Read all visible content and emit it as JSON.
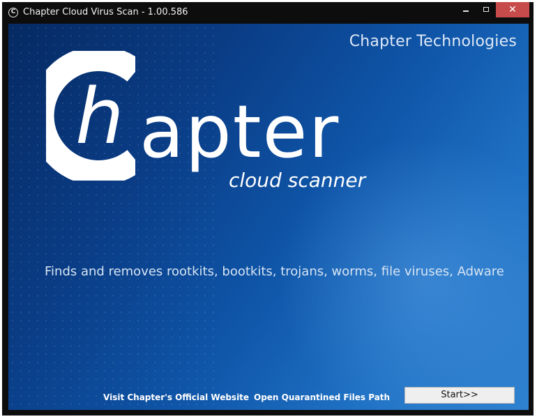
{
  "window": {
    "title": "Chapter Cloud Virus Scan - 1.00.586",
    "icon": "chapter-app-icon",
    "close_glyph": "✕"
  },
  "header": {
    "company": "Chapter Technologies"
  },
  "logo": {
    "letter_c": "C",
    "letter_h": "h",
    "word_rest": "apter",
    "subtitle": "cloud scanner"
  },
  "tagline": "Finds and removes rootkits, bootkits, trojans, worms, file viruses, Adware",
  "footer": {
    "website_link": "Visit Chapter's Official Website",
    "quarantine_link": "Open Quarantined Files Path",
    "start_label": "Start>>"
  },
  "colors": {
    "background_dark": "#062a63",
    "background_light": "#2f82d0",
    "close_button": "#c74b4b",
    "title_bar": "#0d0d0d"
  }
}
